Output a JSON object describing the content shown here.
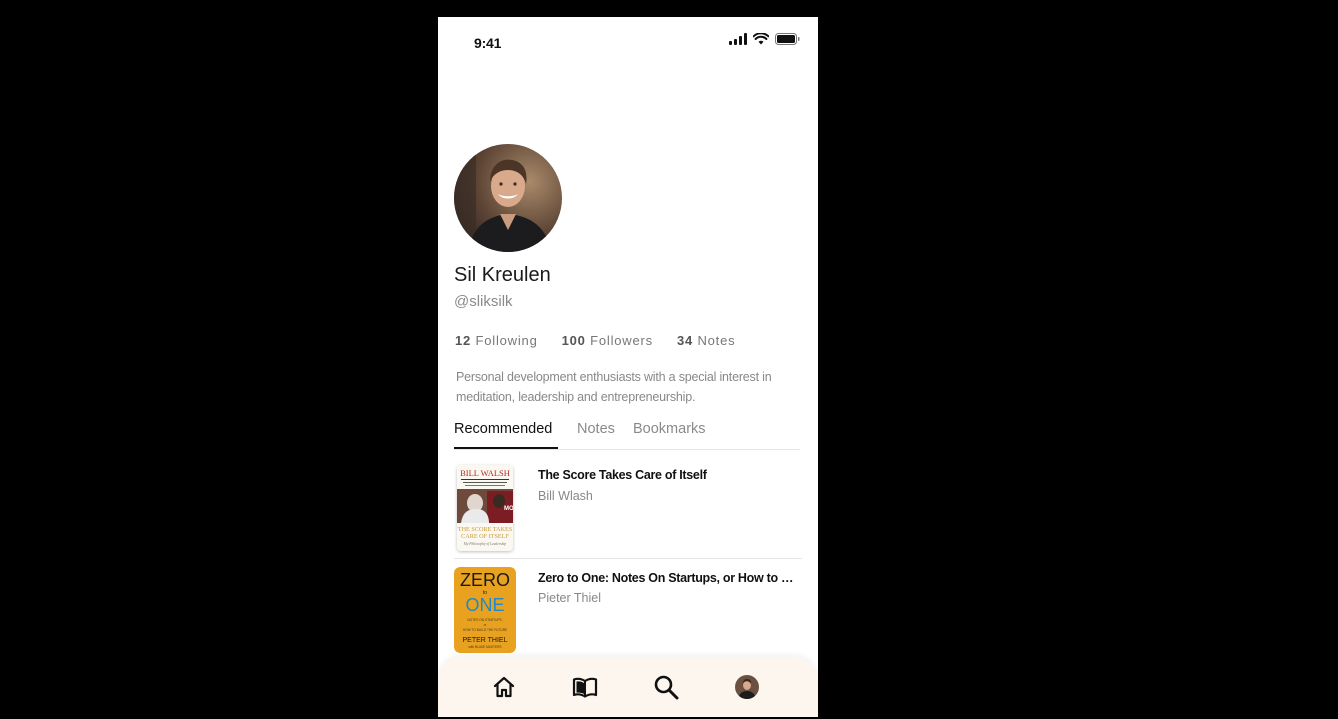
{
  "status_bar": {
    "time": "9:41"
  },
  "profile": {
    "name": "Sil Kreulen",
    "handle": "@sliksilk",
    "stats": [
      {
        "count": "12",
        "label": "Following"
      },
      {
        "count": "100",
        "label": "Followers"
      },
      {
        "count": "34",
        "label": "Notes"
      }
    ],
    "bio": "Personal development enthusiasts with a special interest  in meditation, leadership and entrepreneurship."
  },
  "tabs": [
    {
      "label": "Recommended",
      "active": true
    },
    {
      "label": "Notes",
      "active": false
    },
    {
      "label": "Bookmarks",
      "active": false
    }
  ],
  "books": [
    {
      "title": "The Score Takes Care of Itself",
      "author": "Bill Wlash",
      "cover": {
        "top_text": "BILL WALSH",
        "bottom_text": "THE SCORE TAKES CARE OF ITSELF",
        "tagline": "My Philosophy of Leadership"
      }
    },
    {
      "title": "Zero to One: Notes On Startups, or How to Build the Future",
      "author": "Pieter Thiel",
      "cover": {
        "line1": "ZERO",
        "line2": "to",
        "line3": "ONE",
        "sub": "NOTES ON STARTUPS, or HOW TO BUILD THE FUTURE",
        "author_line": "PETER THIEL",
        "coauthor": "with BLAKE MASTERS"
      }
    }
  ],
  "nav": [
    {
      "icon": "home-icon"
    },
    {
      "icon": "book-icon"
    },
    {
      "icon": "search-icon"
    },
    {
      "icon": "profile-avatar"
    }
  ],
  "colors": {
    "navbar_bg": "#fdf6ef",
    "zero_cover": "#e8a21f",
    "zero_text": "#1f8ac4"
  }
}
